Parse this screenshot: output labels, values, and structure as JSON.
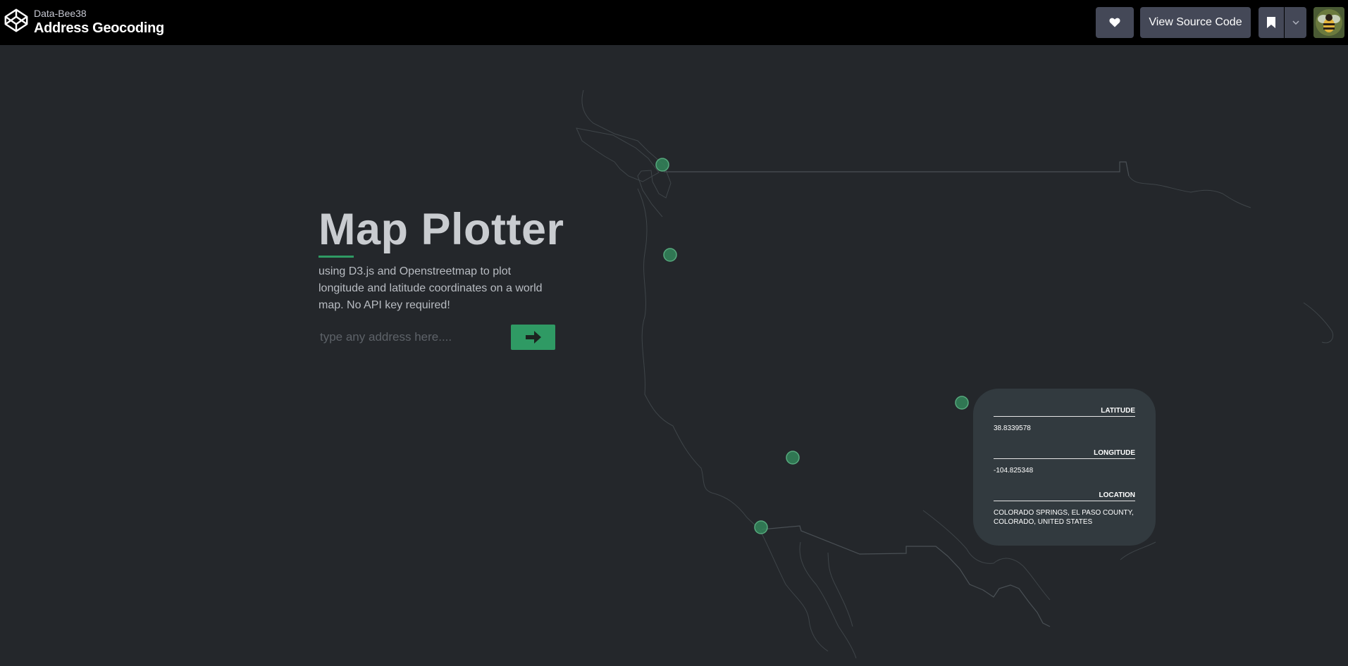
{
  "header": {
    "owner": "Data-Bee38",
    "title": "Address Geocoding",
    "source_label": "View Source Code"
  },
  "hero": {
    "title": "Map Plotter",
    "description": "using D3.js and Openstreetmap to plot longitude and latitude coordinates on a world map. No API key required!"
  },
  "search": {
    "placeholder": "type any address here....",
    "value": ""
  },
  "info_card": {
    "latitude_label": "LATITUDE",
    "latitude_value": "38.8339578",
    "longitude_label": "LONGITUDE",
    "longitude_value": "-104.825348",
    "location_label": "LOCATION",
    "location_value": "COLORADO SPRINGS, EL PASO COUNTY, COLORADO, UNITED STATES"
  },
  "colors": {
    "accent": "#2f9a64",
    "marker": "#3a8a60",
    "background": "#24272b",
    "card": "#323a3f"
  },
  "icons": [
    "codepen-logo-icon",
    "heart-icon",
    "bookmark-icon",
    "chevron-down-icon",
    "arrow-right-icon"
  ]
}
